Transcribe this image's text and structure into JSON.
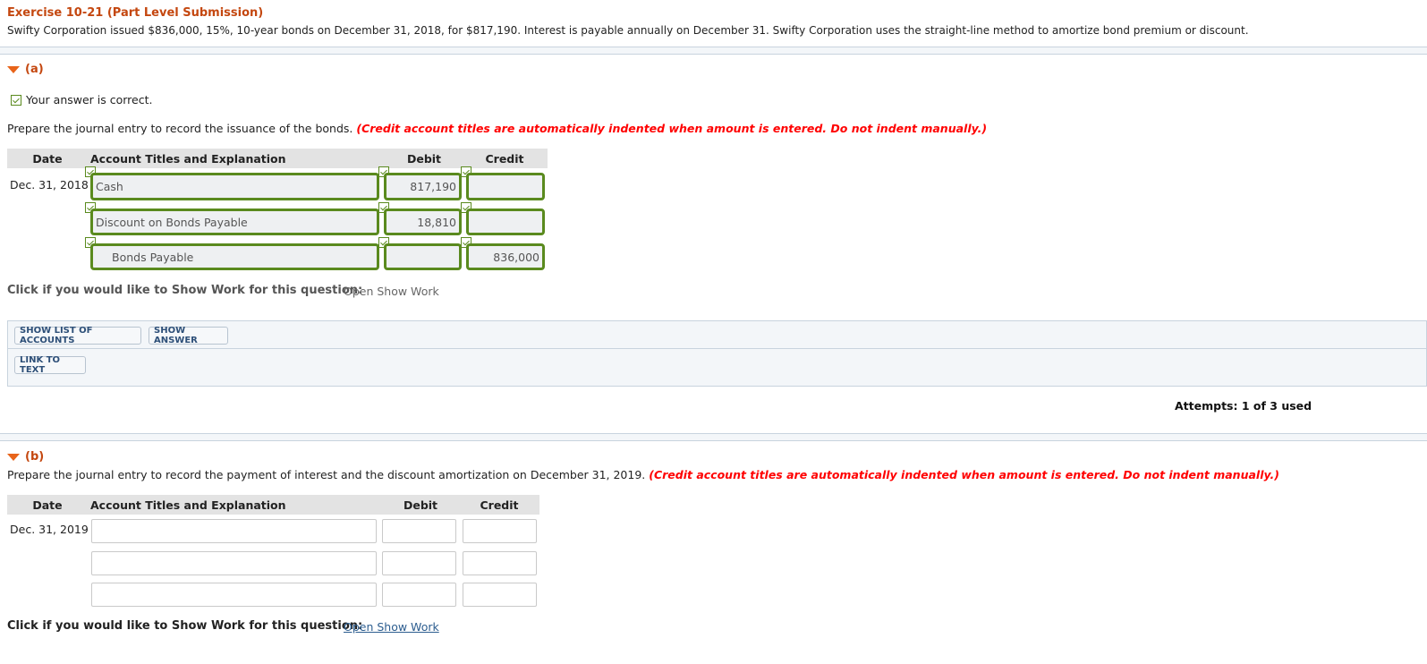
{
  "header": {
    "title": "Exercise 10-21 (Part Level Submission)",
    "problem": "Swifty Corporation issued $836,000, 15%, 10-year bonds on December 31, 2018, for $817,190. Interest is payable annually on December 31. Swifty Corporation uses the straight-line method to amortize bond premium or discount."
  },
  "part_a": {
    "label": "(a)",
    "status": "Your answer is correct.",
    "instruction": "Prepare the journal entry to record the issuance of the bonds.",
    "note": "(Credit account titles are automatically indented when amount is entered. Do not indent manually.)",
    "columns": [
      "Date",
      "Account Titles and Explanation",
      "Debit",
      "Credit"
    ],
    "date": "Dec. 31, 2018",
    "rows": [
      {
        "account": "Cash",
        "debit": "817,190",
        "credit": ""
      },
      {
        "account": "Discount on Bonds Payable",
        "debit": "18,810",
        "credit": ""
      },
      {
        "account": "Bonds Payable",
        "debit": "",
        "credit": "836,000"
      }
    ],
    "show_work_label": "Click if you would like to Show Work for this question:",
    "show_work_link": "Open Show Work",
    "buttons": {
      "show_list": "SHOW LIST OF ACCOUNTS",
      "show_answer": "SHOW ANSWER",
      "link_to_text": "LINK TO TEXT"
    },
    "attempts": "Attempts: 1 of 3 used"
  },
  "part_b": {
    "label": "(b)",
    "instruction": "Prepare the journal entry to record the payment of interest and the discount amortization on December 31, 2019.",
    "note": "(Credit account titles are automatically indented when amount is entered. Do not indent manually.)",
    "columns": [
      "Date",
      "Account Titles and Explanation",
      "Debit",
      "Credit"
    ],
    "date": "Dec. 31, 2019",
    "rows": [
      {
        "account": "",
        "debit": "",
        "credit": ""
      },
      {
        "account": "",
        "debit": "",
        "credit": ""
      },
      {
        "account": "",
        "debit": "",
        "credit": ""
      }
    ],
    "show_work_label": "Click if you would like to Show Work for this question:",
    "show_work_link": "Open Show Work"
  }
}
